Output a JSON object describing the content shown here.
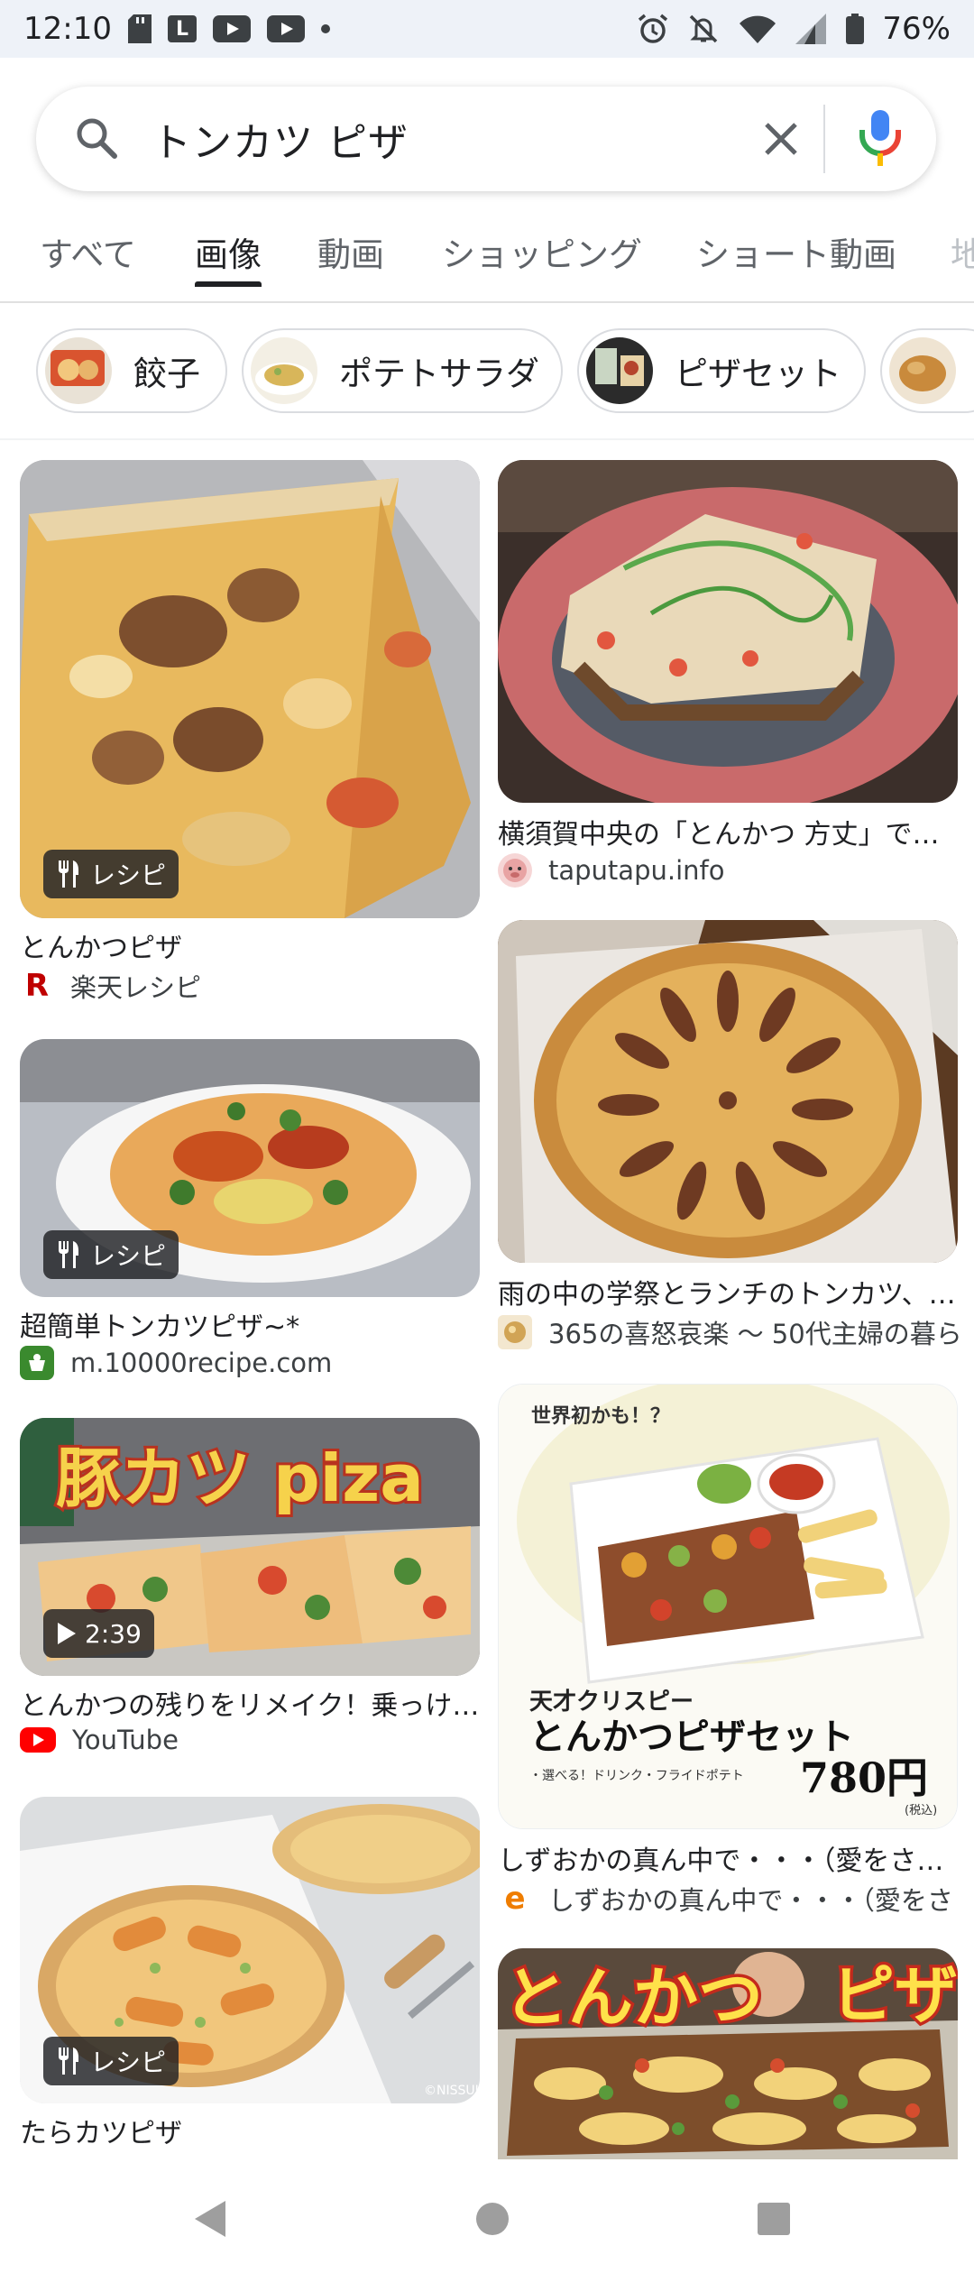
{
  "status_bar": {
    "time": "12:10",
    "battery": "76%",
    "l_badge": "L"
  },
  "search": {
    "query": "トンカツ ピザ"
  },
  "tabs": [
    {
      "label": "すべて"
    },
    {
      "label": "画像"
    },
    {
      "label": "動画"
    },
    {
      "label": "ショッピング"
    },
    {
      "label": "ショート動画"
    },
    {
      "label": "地"
    }
  ],
  "chips": [
    {
      "label": "餃子"
    },
    {
      "label": "ポテトサラダ"
    },
    {
      "label": "ピザセット"
    }
  ],
  "results": [
    {
      "title": "とんかつピザ",
      "source": "楽天レシピ",
      "badge": "レシピ"
    },
    {
      "title": "横須賀中央の「とんかつ 方丈」でめ…",
      "source": "taputapu.info"
    },
    {
      "title": "超簡単トンカツピザ~*",
      "source": "m.10000recipe.com",
      "badge": "レシピ"
    },
    {
      "title": "雨の中の学祭とランチのトンカツ、…",
      "source": "365の喜怒哀楽 ～ 50代主婦の暮ら"
    },
    {
      "title": "とんかつの残りをリメイク！乗っけ…",
      "source": "YouTube",
      "badge": "2:39",
      "thumb_text": "豚カツ piza"
    },
    {
      "title": "しずおかの真ん中で・・・（愛をさ…",
      "source": "しずおかの真ん中で・・・（愛をさ",
      "thumb_text": {
        "top": "世界初かも！？",
        "sub": "天才クリスピー",
        "main": "とんかつピザセット",
        "notes": "・選べる！ドリンク・フライドポテト",
        "price": "780円",
        "tax": "(税込)"
      }
    },
    {
      "title": "たらカツピザ",
      "badge": "レシピ",
      "watermark": "©NISSUI"
    },
    {
      "thumb_text": {
        "left": "とんかつ",
        "right": "ピザ"
      }
    }
  ],
  "favicons": {
    "rakuten": "R",
    "eonet": "e"
  },
  "colors": {
    "accent": "#202124",
    "muted": "#5f6368",
    "youtube": "#ff0000",
    "rakuten": "#bf0000"
  }
}
